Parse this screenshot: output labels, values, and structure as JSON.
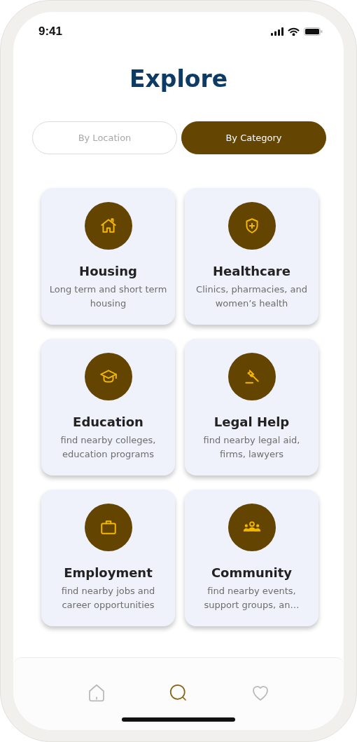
{
  "status_bar": {
    "time": "9:41"
  },
  "title": "Explore",
  "tabs": [
    {
      "label": "By Location",
      "selected": false
    },
    {
      "label": "By Category",
      "selected": true
    }
  ],
  "categories": [
    {
      "kind": "housing",
      "title": "Housing",
      "description": "Long term and short term housing"
    },
    {
      "kind": "healthcare",
      "title": "Healthcare",
      "description": "Clinics, pharmacies, and women’s health"
    },
    {
      "kind": "education",
      "title": "Education",
      "description": "find nearby colleges, education programs"
    },
    {
      "kind": "legal",
      "title": "Legal Help",
      "description": "find nearby legal aid, firms, lawyers"
    },
    {
      "kind": "employment",
      "title": "Employment",
      "description": "find nearby jobs and career opportunities"
    },
    {
      "kind": "community",
      "title": "Community",
      "description": "find nearby events, support groups, an…"
    }
  ],
  "bottom_nav": [
    {
      "kind": "home",
      "selected": false
    },
    {
      "kind": "search",
      "selected": true
    },
    {
      "kind": "favorites",
      "selected": false
    }
  ]
}
